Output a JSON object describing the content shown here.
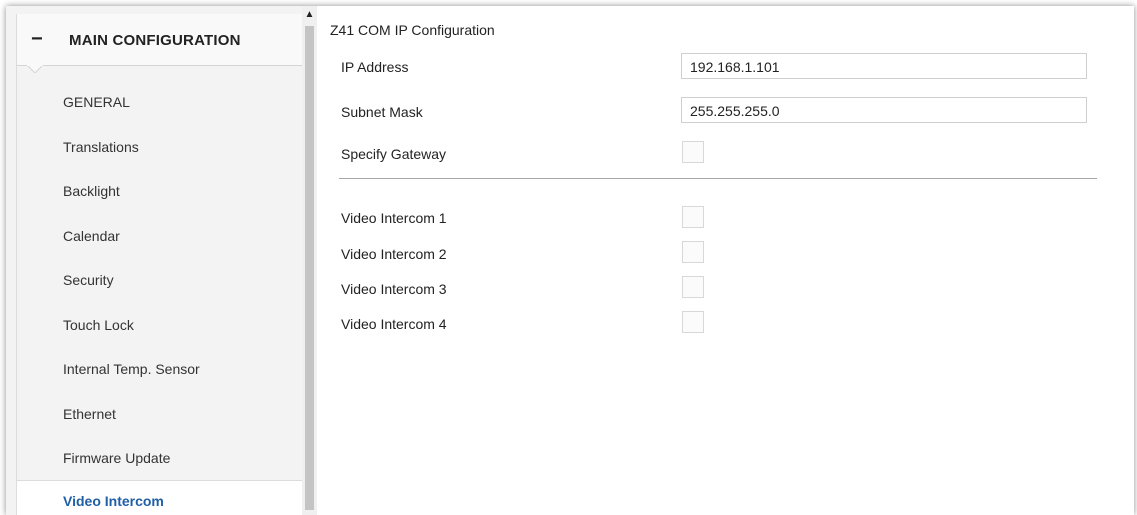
{
  "sidebar": {
    "section_label": "MAIN CONFIGURATION",
    "collapse_symbol": "−",
    "items": [
      {
        "label": "GENERAL"
      },
      {
        "label": "Translations"
      },
      {
        "label": "Backlight"
      },
      {
        "label": "Calendar"
      },
      {
        "label": "Security"
      },
      {
        "label": "Touch Lock"
      },
      {
        "label": "Internal Temp. Sensor"
      },
      {
        "label": "Ethernet"
      },
      {
        "label": "Firmware Update"
      },
      {
        "label": "Video Intercom",
        "active": true
      }
    ],
    "active_color": "#1f5fa6"
  },
  "scrollbar": {
    "up_arrow": "▲"
  },
  "content": {
    "title": "Z41 COM IP Configuration",
    "ip_address": {
      "label": "IP Address",
      "value": "192.168.1.101"
    },
    "subnet_mask": {
      "label": "Subnet Mask",
      "value": "255.255.255.0"
    },
    "specify_gateway": {
      "label": "Specify Gateway",
      "checked": false
    },
    "intercoms": [
      {
        "label": "Video Intercom 1",
        "checked": false
      },
      {
        "label": "Video Intercom 2",
        "checked": false
      },
      {
        "label": "Video Intercom 3",
        "checked": false
      },
      {
        "label": "Video Intercom 4",
        "checked": false
      }
    ]
  }
}
